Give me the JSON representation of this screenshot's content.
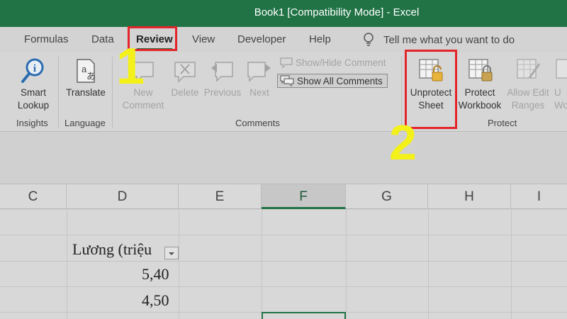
{
  "window": {
    "title": "Book1  [Compatibility Mode]  -  Excel"
  },
  "tabs": [
    {
      "label": "Formulas"
    },
    {
      "label": "Data"
    },
    {
      "label": "Review",
      "active": true
    },
    {
      "label": "View"
    },
    {
      "label": "Developer"
    },
    {
      "label": "Help"
    }
  ],
  "tell_me": "Tell me what you want to do",
  "ribbon": {
    "insights": {
      "label": "Insights",
      "smart_lookup_1": "Smart",
      "smart_lookup_2": "Lookup"
    },
    "language": {
      "label": "Language",
      "translate": "Translate"
    },
    "comments": {
      "label": "Comments",
      "new_1": "New",
      "new_2": "Comment",
      "delete": "Delete",
      "previous": "Previous",
      "next": "Next",
      "show_hide": "Show/Hide Comment",
      "show_all": "Show All Comments"
    },
    "protect": {
      "label": "Protect",
      "unprotect_1": "Unprotect",
      "unprotect_2": "Sheet",
      "protect_wb_1": "Protect",
      "protect_wb_2": "Workbook",
      "allow_edit_1": "Allow Edit",
      "allow_edit_2": "Ranges",
      "unshare_1": "U",
      "unshare_2": "Wo"
    }
  },
  "columns": [
    "C",
    "D",
    "E",
    "F",
    "G",
    "H",
    "I"
  ],
  "selected_column": "F",
  "cells": {
    "header": "Lương (triệu",
    "row1": "5,40",
    "row2": "4,50"
  },
  "annotations": {
    "step1": "1",
    "step2": "2"
  },
  "colors": {
    "accent": "#217346",
    "highlight_box": "#e3242b",
    "annotation_text": "#f3f01a"
  }
}
